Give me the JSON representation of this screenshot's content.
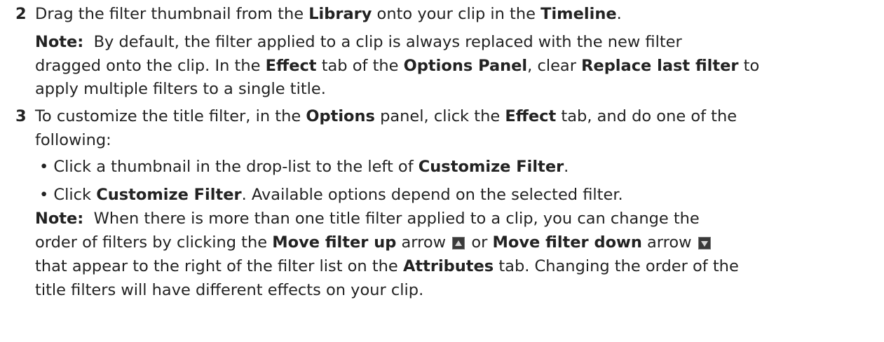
{
  "step2": {
    "number": "2",
    "line1": [
      "Drag the filter thumbnail from the ",
      "Library",
      " onto your clip in the ",
      "Timeline",
      "."
    ],
    "note_label": "Note:",
    "note_line1": "By default, the filter applied to a clip is always replaced with the new filter",
    "note_line2": [
      "dragged onto the clip. In the ",
      "Effect",
      " tab of the ",
      "Options Panel",
      ", clear ",
      "Replace last filter",
      " to"
    ],
    "note_line3": "apply multiple filters to a single title."
  },
  "step3": {
    "number": "3",
    "line1": [
      "To customize the title filter, in the ",
      "Options",
      " panel, click the ",
      "Effect",
      " tab, and do one of the"
    ],
    "line2": "following:",
    "bullet1": [
      "• Click a thumbnail in the drop-list to the left of ",
      "Customize Filter",
      "."
    ],
    "bullet2": [
      "• Click ",
      "Customize Filter",
      ". Available options depend on the selected filter."
    ],
    "note_label": "Note:",
    "note_line1": "When there is more than one title filter applied to a clip, you can change the",
    "note_line2": [
      "order of filters by clicking the ",
      "Move filter up",
      " arrow ",
      " or ",
      "Move filter down",
      " arrow "
    ],
    "note_line3": [
      "that appear to the right of the filter list on the ",
      "Attributes",
      " tab. Changing the order of the"
    ],
    "note_line4": "title filters will have different effects on your clip.",
    "icon_up": "move-filter-up-icon",
    "icon_down": "move-filter-down-icon"
  }
}
